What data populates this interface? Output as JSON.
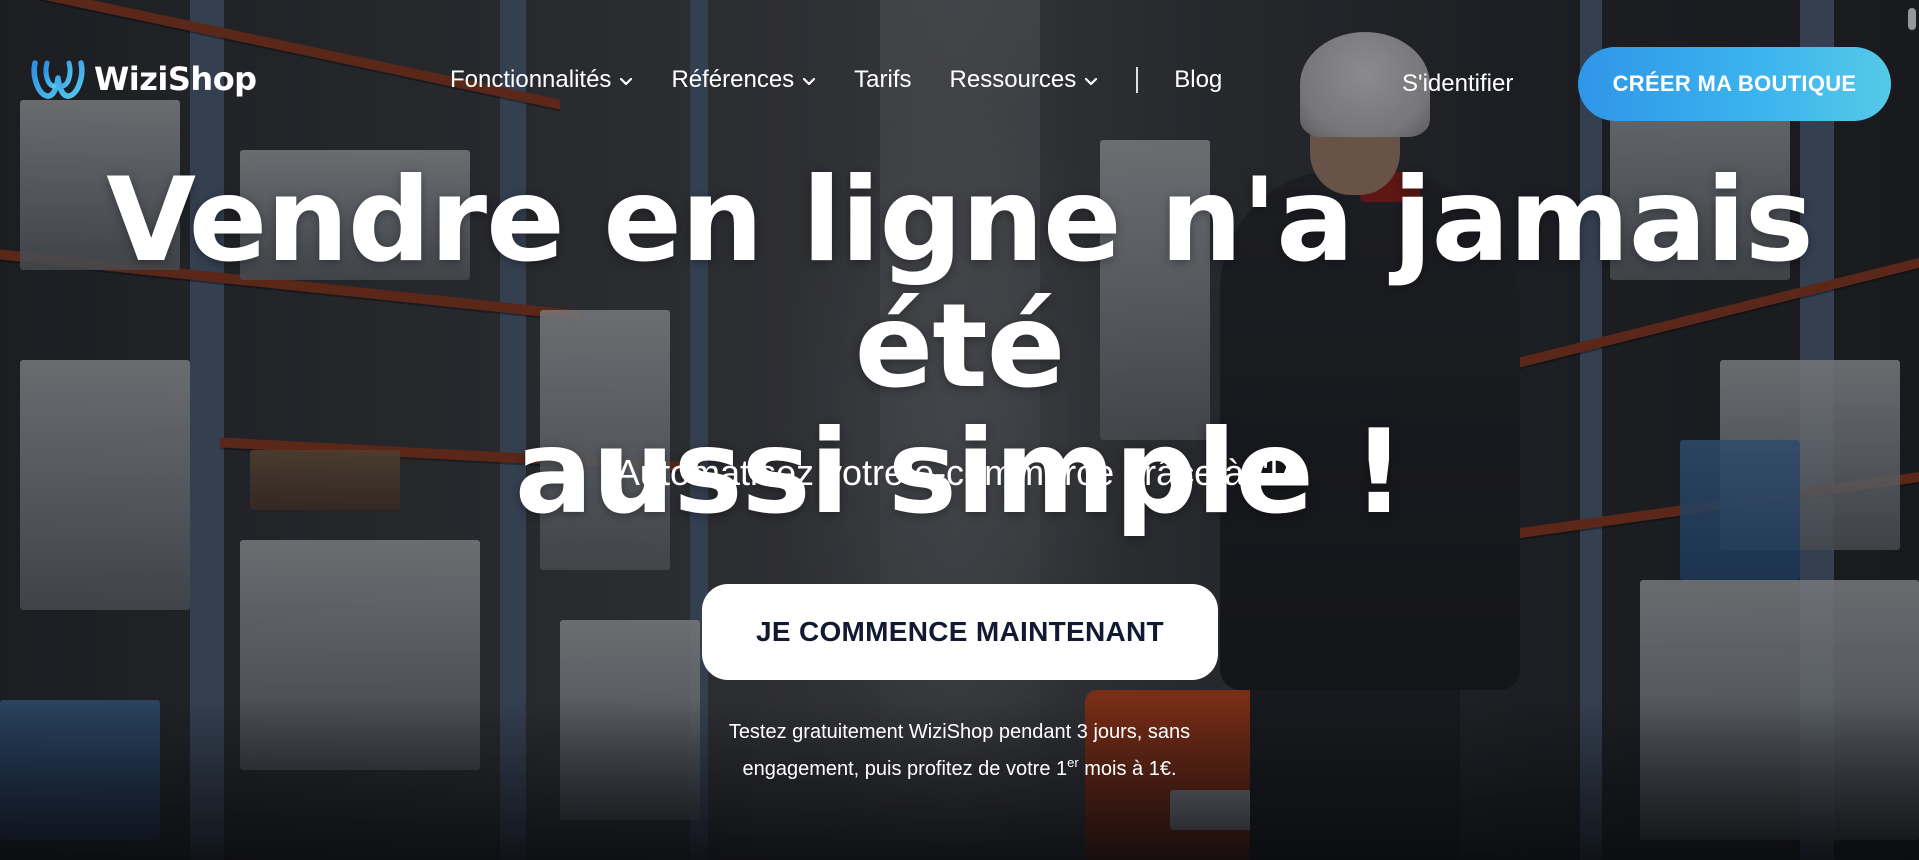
{
  "brand": {
    "name": "WiziShop",
    "logo_icon": "wizishop-w-logo-icon",
    "accent_color": "#3ab2ee"
  },
  "nav": {
    "items": [
      {
        "label": "Fonctionnalités",
        "has_dropdown": true
      },
      {
        "label": "Références",
        "has_dropdown": true
      },
      {
        "label": "Tarifs",
        "has_dropdown": false
      },
      {
        "label": "Ressources",
        "has_dropdown": true
      }
    ],
    "blog_label": "Blog",
    "login_label": "S'identifier",
    "cta_label": "CRÉER MA BOUTIQUE"
  },
  "hero": {
    "title_line1": "Vendre en ligne n'a jamais été",
    "title_line2": "aussi simple !",
    "subtitle": "Automatisez votre e-commerce grâce à l'IA",
    "button_label": "JE COMMENCE MAINTENANT",
    "note_line1": "Testez gratuitement WiziShop pendant 3 jours, sans",
    "note_line2_before": "engagement, puis profitez de votre 1",
    "note_line2_sup": "er",
    "note_line2_after": " mois à 1€.",
    "button_text_color": "#121a33"
  }
}
